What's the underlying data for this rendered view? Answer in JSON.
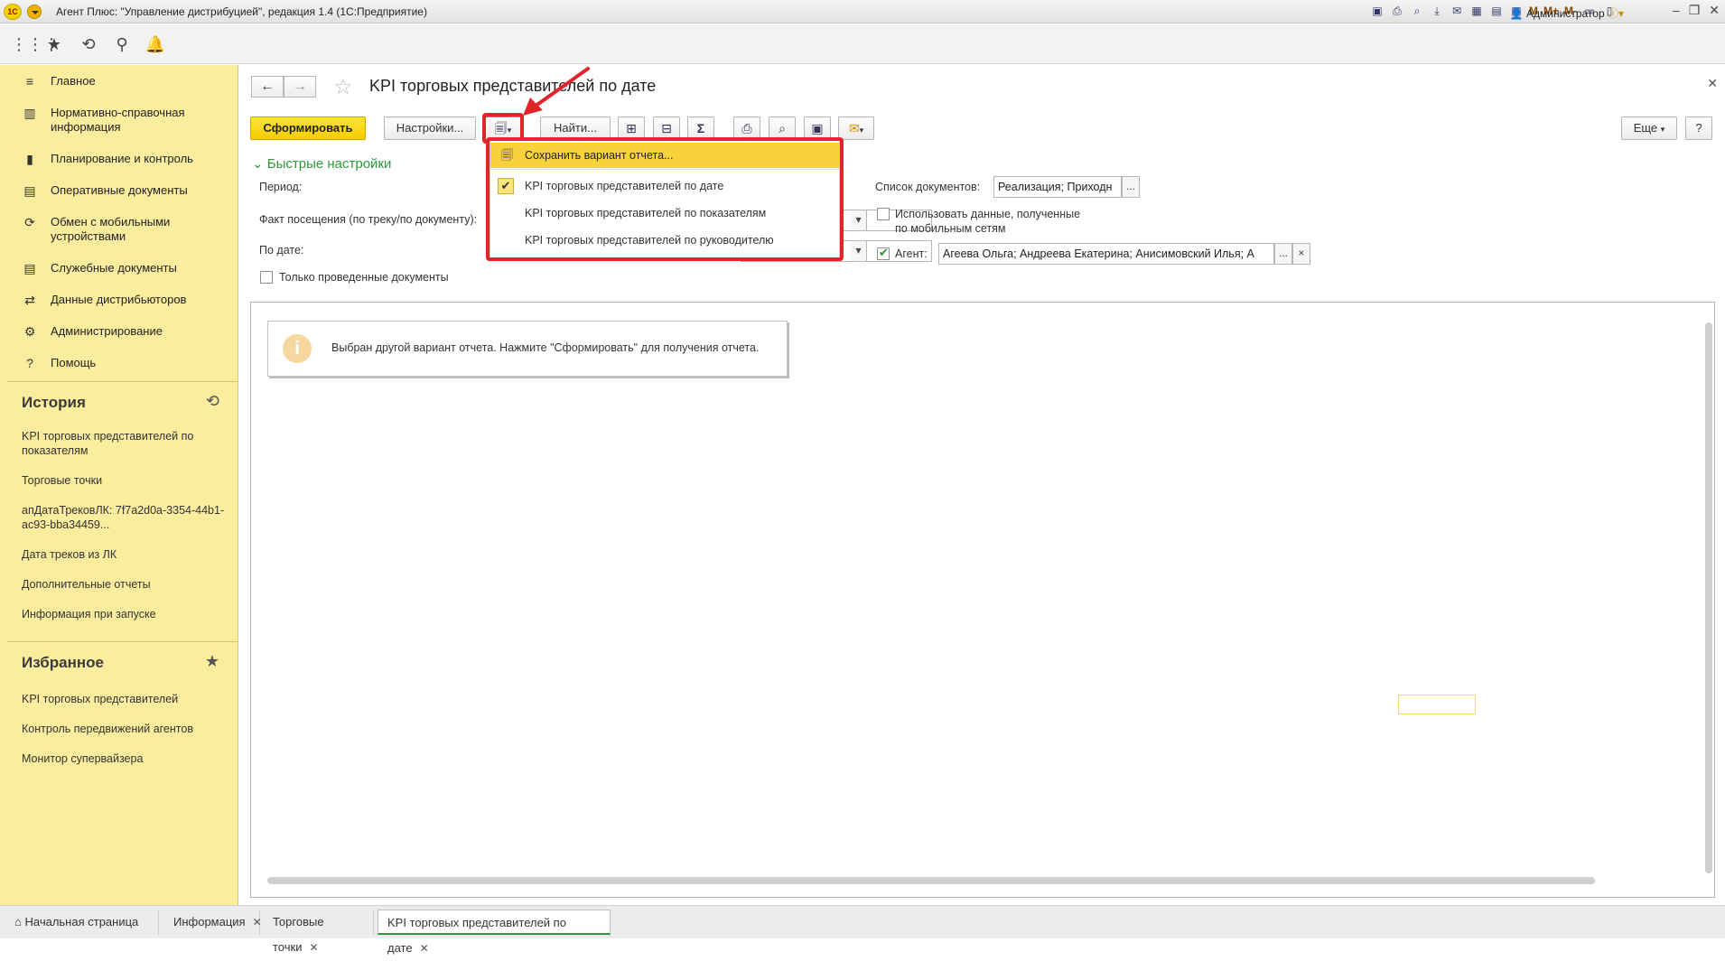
{
  "window": {
    "title": "Агент Плюс: \"Управление дистрибуцией\", редакция 1.4  (1С:Предприятие)",
    "logo_text": "1С",
    "user": "Администратор",
    "mem_buttons": [
      "M",
      "M+",
      "M-"
    ]
  },
  "sidebar": {
    "items": [
      {
        "icon": "≡",
        "label": "Главное"
      },
      {
        "icon": "▥",
        "label": "Нормативно-справочная информация"
      },
      {
        "icon": "▮",
        "label": "Планирование и контроль"
      },
      {
        "icon": "▤",
        "label": "Оперативные документы"
      },
      {
        "icon": "⟳",
        "label": "Обмен с мобильными устройствами"
      },
      {
        "icon": "▤",
        "label": "Служебные документы"
      },
      {
        "icon": "⇄",
        "label": "Данные дистрибьюторов"
      },
      {
        "icon": "⚙",
        "label": "Администрирование"
      },
      {
        "icon": "?",
        "label": "Помощь"
      }
    ],
    "history_title": "История",
    "history": [
      "KPI торговых представителей по показателям",
      "Торговые точки",
      "апДатаТрековЛК: 7f7a2d0a-3354-44b1-ac93-bba34459...",
      "Дата треков из ЛК",
      "Дополнительные отчеты",
      "Информация при запуске"
    ],
    "favorites_title": "Избранное",
    "favorites": [
      "KPI торговых представителей",
      "Контроль передвижений агентов",
      "Монитор супервайзера"
    ]
  },
  "form": {
    "title": "KPI торговых представителей по дате",
    "generate_label": "Сформировать",
    "settings_label": "Настройки...",
    "find_label": "Найти...",
    "more_label": "Еще",
    "help_label": "?",
    "sum_label": "Σ",
    "quick_settings": "Быстрые настройки",
    "period_label": "Период:",
    "visit_fact_label": "Факт посещения (по треку/по документу):",
    "by_date_label": "По дате:",
    "posted_only_label": "Только проведенные документы",
    "doc_list_label": "Список документов:",
    "doc_list_value": "Реализация; Приходн",
    "mobile_data_label": "Использовать данные, полученные по мобильным сетям",
    "agent_label": "Агент:",
    "agent_value": "Агеева Ольга; Андреева Екатерина; Анисимовский Илья; А",
    "ellipsis": "...",
    "clear": "×"
  },
  "message": {
    "icon": "i",
    "text": "Выбран другой вариант отчета. Нажмите \"Сформировать\" для получения отчета."
  },
  "popup": {
    "save_label": "Сохранить вариант отчета...",
    "variants": [
      {
        "label": "KPI торговых представителей по дате",
        "checked": true
      },
      {
        "label": "KPI торговых представителей по показателям",
        "checked": false
      },
      {
        "label": "KPI торговых представителей по руководителю",
        "checked": false
      }
    ]
  },
  "tabs": [
    {
      "label": "Начальная страница",
      "closable": false
    },
    {
      "label": "Информация",
      "closable": true
    },
    {
      "label": "Торговые точки",
      "closable": true
    },
    {
      "label": "KPI торговых представителей по дате",
      "closable": true,
      "active": true
    }
  ],
  "colors": {
    "sidebar_bg": "#fbec9e",
    "accent_yellow": "#f5cc00",
    "highlight_red": "#e2252a",
    "quick_green": "#2c9a3a"
  }
}
